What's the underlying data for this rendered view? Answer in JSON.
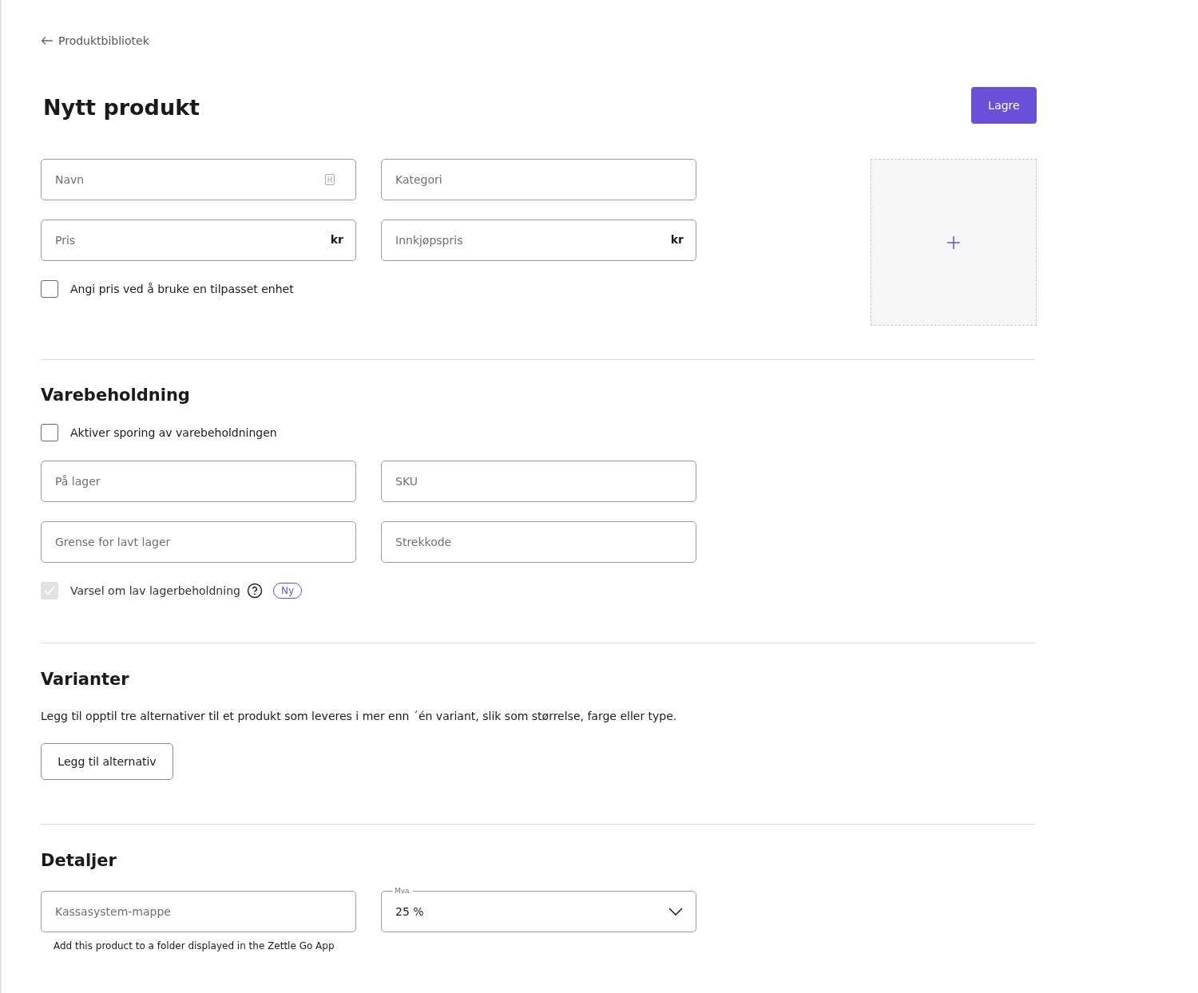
{
  "breadcrumb": {
    "label": "Produktbibliotek"
  },
  "title": "Nytt produkt",
  "save_button": "Lagre",
  "product_fields": [
    {
      "placeholder": "Navn",
      "kind": "icon"
    },
    {
      "placeholder": "Kategori",
      "kind": "plain"
    },
    {
      "placeholder": "Pris",
      "kind": "suffix",
      "suffix": "kr"
    },
    {
      "placeholder": "Innkjøpspris",
      "kind": "suffix",
      "suffix": "kr"
    }
  ],
  "custom_unit": {
    "label": "Angi pris ved å bruke en tilpasset enhet",
    "checked": false,
    "disabled": false
  },
  "inventory": {
    "heading": "Varebeholdning",
    "tracking": {
      "label": "Aktiver sporing av varebeholdningen",
      "checked": false,
      "disabled": false
    },
    "fields": [
      {
        "placeholder": "På lager",
        "kind": "plain"
      },
      {
        "placeholder": "SKU",
        "kind": "plain"
      },
      {
        "placeholder": "Grense for lavt lager",
        "kind": "plain"
      },
      {
        "placeholder": "Strekkode",
        "kind": "plain"
      }
    ],
    "low_stock_alert": {
      "label": "Varsel om lav lagerbeholdning",
      "checked": true,
      "disabled": true,
      "badge": "Ny"
    }
  },
  "variants": {
    "heading": "Varianter",
    "description": "Legg til opptil tre alternativer til et produkt som leveres i mer enn ´én variant, slik som størrelse, farge eller type.",
    "button": "Legg til alternativ"
  },
  "details": {
    "heading": "Detaljer",
    "folder_field": {
      "placeholder": "Kassasystem-mappe",
      "helper": "Add this product to a folder displayed in the Zettle Go App"
    },
    "vat_select": {
      "label": "Mva.",
      "value": "25 %"
    }
  }
}
